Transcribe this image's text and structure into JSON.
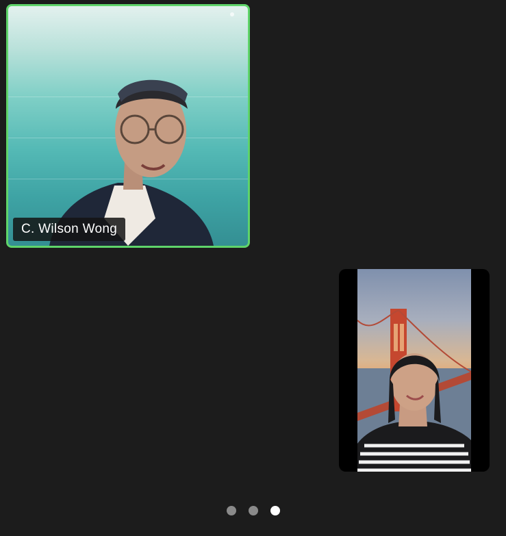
{
  "participants": [
    {
      "name": "C. Wilson Wong",
      "active_speaker": true
    },
    {
      "name": "",
      "active_speaker": false
    }
  ],
  "colors": {
    "background": "#1c1c1c",
    "active_speaker_border": "#5fd46a",
    "name_tag_bg": "#141414",
    "name_tag_text": "#ffffff",
    "page_dot_inactive": "#8a8a8a",
    "page_dot_active": "#ffffff"
  },
  "pager": {
    "total_pages": 3,
    "current_page": 3
  }
}
